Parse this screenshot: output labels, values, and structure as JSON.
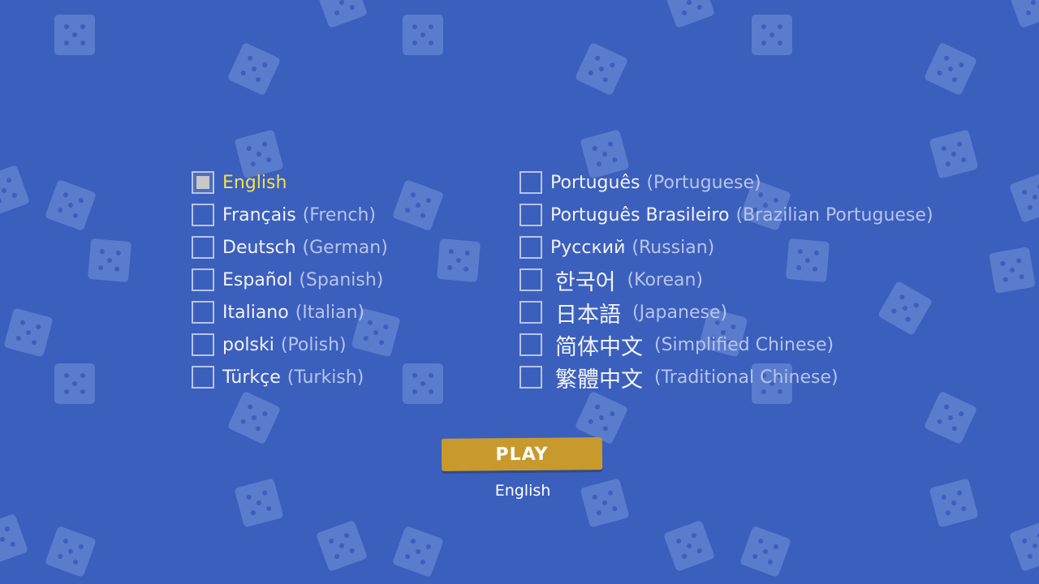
{
  "colors": {
    "background": "#3b5fbd",
    "die": "#5a7ccc",
    "selected_text": "#f2e14c",
    "native_text": "#f2f2f2",
    "english_text": "#b8c4e8",
    "play_button": "#c89a2e"
  },
  "languages_left": [
    {
      "native": "English",
      "english": "",
      "checked": true
    },
    {
      "native": "Français",
      "english": "(French)",
      "checked": false
    },
    {
      "native": "Deutsch",
      "english": "(German)",
      "checked": false
    },
    {
      "native": "Español",
      "english": "(Spanish)",
      "checked": false
    },
    {
      "native": "Italiano",
      "english": "(Italian)",
      "checked": false
    },
    {
      "native": "polski",
      "english": "(Polish)",
      "checked": false
    },
    {
      "native": "Türkçe",
      "english": "(Turkish)",
      "checked": false
    }
  ],
  "languages_right": [
    {
      "native": "Português",
      "english": "(Portuguese)",
      "checked": false
    },
    {
      "native": "Português Brasileiro",
      "english": "(Brazilian Portuguese)",
      "checked": false
    },
    {
      "native": "Русский",
      "english": "(Russian)",
      "checked": false
    },
    {
      "native": "한국어",
      "english": "(Korean)",
      "checked": false
    },
    {
      "native": "日本語",
      "english": "(Japanese)",
      "checked": false
    },
    {
      "native": "简体中文",
      "english": "(Simplified Chinese)",
      "checked": false
    },
    {
      "native": "繁體中文",
      "english": "(Traditional Chinese)",
      "checked": false
    }
  ],
  "play": {
    "label": "PLAY",
    "current_language": "English"
  }
}
